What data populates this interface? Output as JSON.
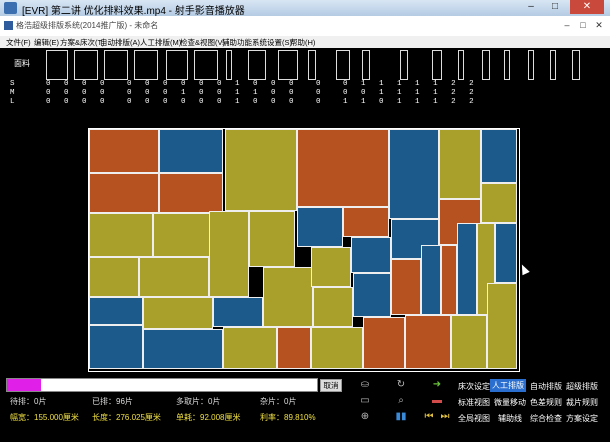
{
  "player": {
    "title": "[EVR] 第二讲 优化排料效果.mp4 - 射手影音播放器",
    "min": "–",
    "max": "□",
    "close": "✕"
  },
  "app": {
    "title": "格浩超级排版系统(2014推广版) - 未命名"
  },
  "menu": [
    "文件(F)",
    "编辑(E)",
    "方案&床次(T)",
    "自动排版(A)",
    "人工排版(M)",
    "检查&视图(V)",
    "辅助功能",
    "系统设置(S)",
    "帮助(H)"
  ],
  "material_label": "面料",
  "size_labels": [
    "S",
    "M",
    "L"
  ],
  "size_rows": [
    "0   0   0   0     0   0   0   0   0   0   1   0   0   0     0     0   1   1   1   1   1   2   2",
    "0   0   0   0     0   0   0   1   0   0   1   1   0   0     0     0   0   1   1   1   1   2   2",
    "0   0   0   0     0   0   0   0   0   0   1   0   0   0     0     1   1   0   1   1   1   2   2"
  ],
  "progress": {
    "fraction": 0.11,
    "cancel_label": "取消"
  },
  "status": {
    "pending": "待排：0片",
    "placed": "已排：96片",
    "extra": "多取片：0片",
    "misc": "杂片：0片",
    "width": "幅宽：155.000厘米",
    "length": "长度：276.025厘米",
    "per_unit": "单耗：92.008厘米",
    "utilization": "利率：89.810%"
  },
  "buttons": {
    "row1": [
      "床次设定",
      "人工排版",
      "自动排版",
      "超级排版"
    ],
    "row2": [
      "标准视图",
      "微量移动",
      "色差规则",
      "裁片规则"
    ],
    "row3": [
      "全局视图",
      "辅助线",
      "综合检查",
      "方案设定"
    ]
  },
  "colors": {
    "brown": "#b5521f",
    "blue": "#1d5a8c",
    "olive": "#a8a02a",
    "active": "#2a6fd0",
    "progress": "#e020e8"
  }
}
